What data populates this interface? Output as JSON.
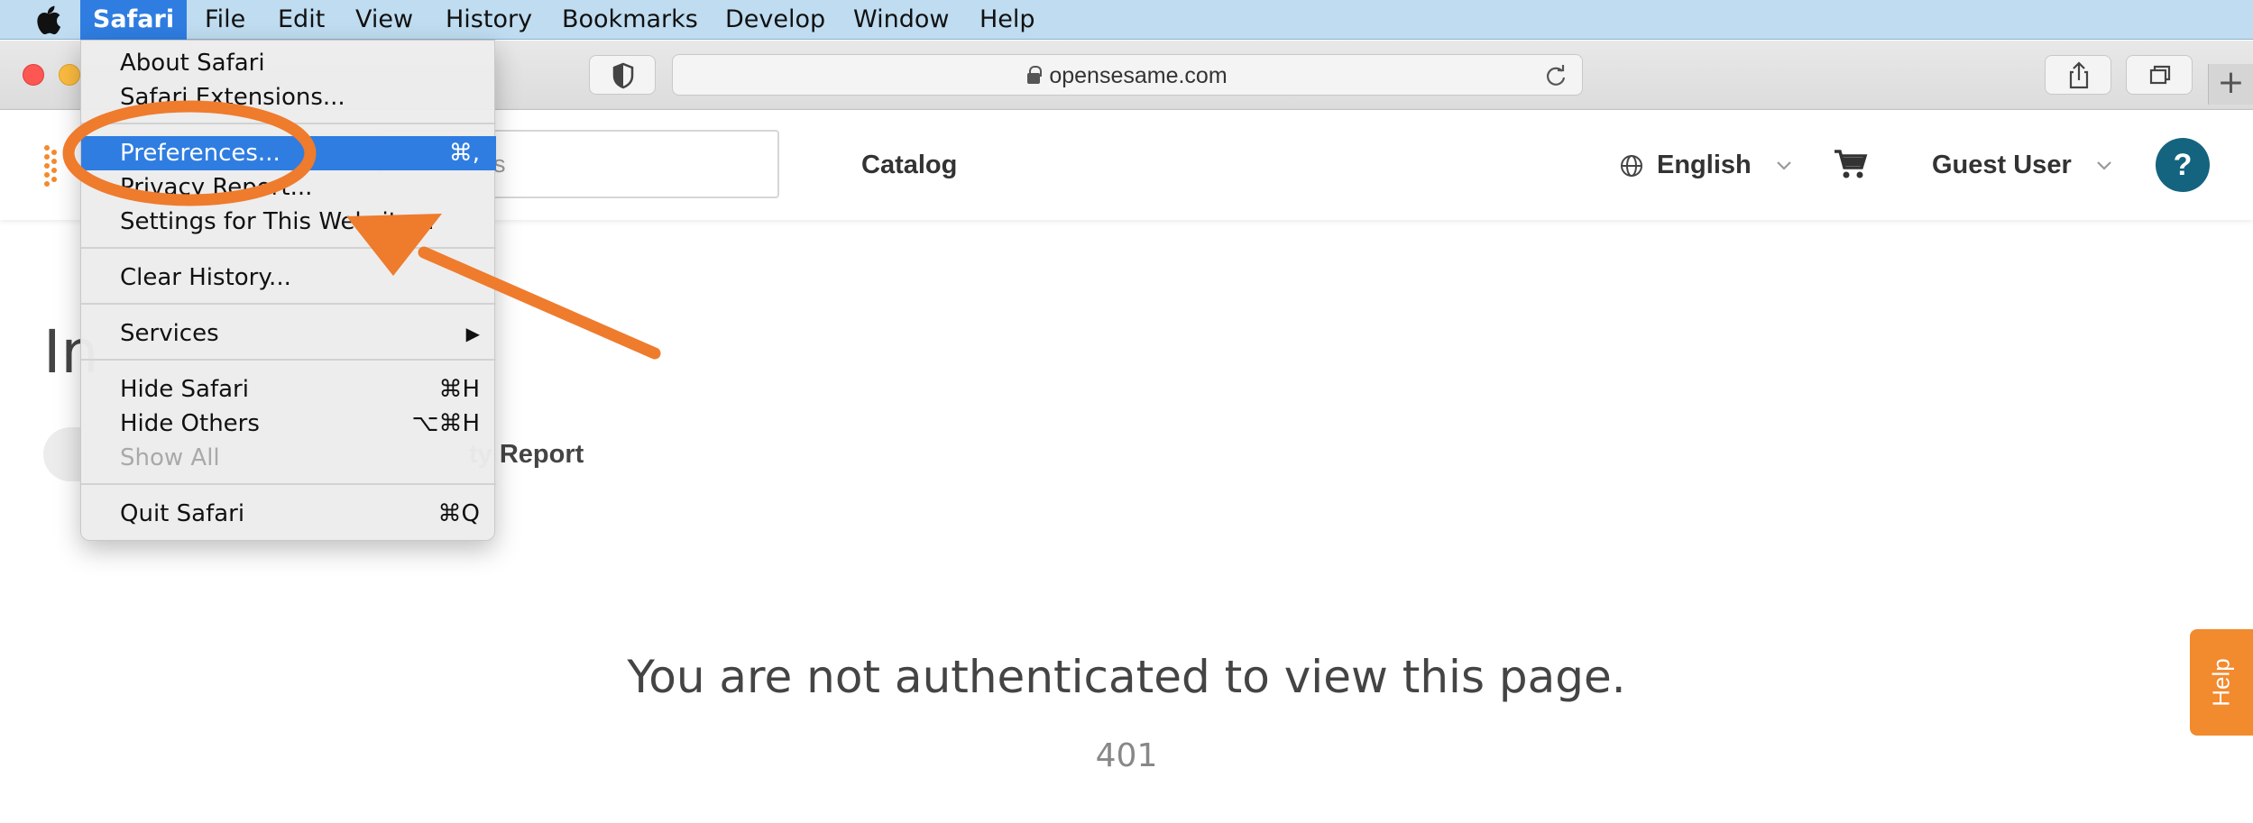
{
  "menubar": {
    "app_menu": "Safari",
    "items": [
      "File",
      "Edit",
      "View",
      "History",
      "Bookmarks",
      "Develop",
      "Window",
      "Help"
    ]
  },
  "toolbar": {
    "url": "opensesame.com"
  },
  "header": {
    "search_placeholder_fragment": "es",
    "catalog": "Catalog",
    "language": "English",
    "user": "Guest User",
    "help_button": "?"
  },
  "page": {
    "title_fragment": "In",
    "report_fragment": "ty Report",
    "error_message": "You are not authenticated to view this page.",
    "error_code": "401",
    "help_tab": "Help"
  },
  "safari_menu": {
    "about": "About Safari",
    "extensions": "Safari Extensions...",
    "preferences": "Preferences...",
    "preferences_shortcut": "⌘,",
    "privacy": "Privacy Report...",
    "settings_site": "Settings for This Website...",
    "clear_history": "Clear History...",
    "services": "Services",
    "services_arrow": "▶",
    "hide_safari": "Hide Safari",
    "hide_safari_shortcut": "⌘H",
    "hide_others": "Hide Others",
    "hide_others_shortcut": "⌥⌘H",
    "show_all": "Show All",
    "quit": "Quit Safari",
    "quit_shortcut": "⌘Q"
  },
  "colors": {
    "menu_highlight": "#2f7de1",
    "annotation": "#ef7b2d",
    "help_tab": "#f28a2e",
    "help_circle": "#14647f"
  }
}
